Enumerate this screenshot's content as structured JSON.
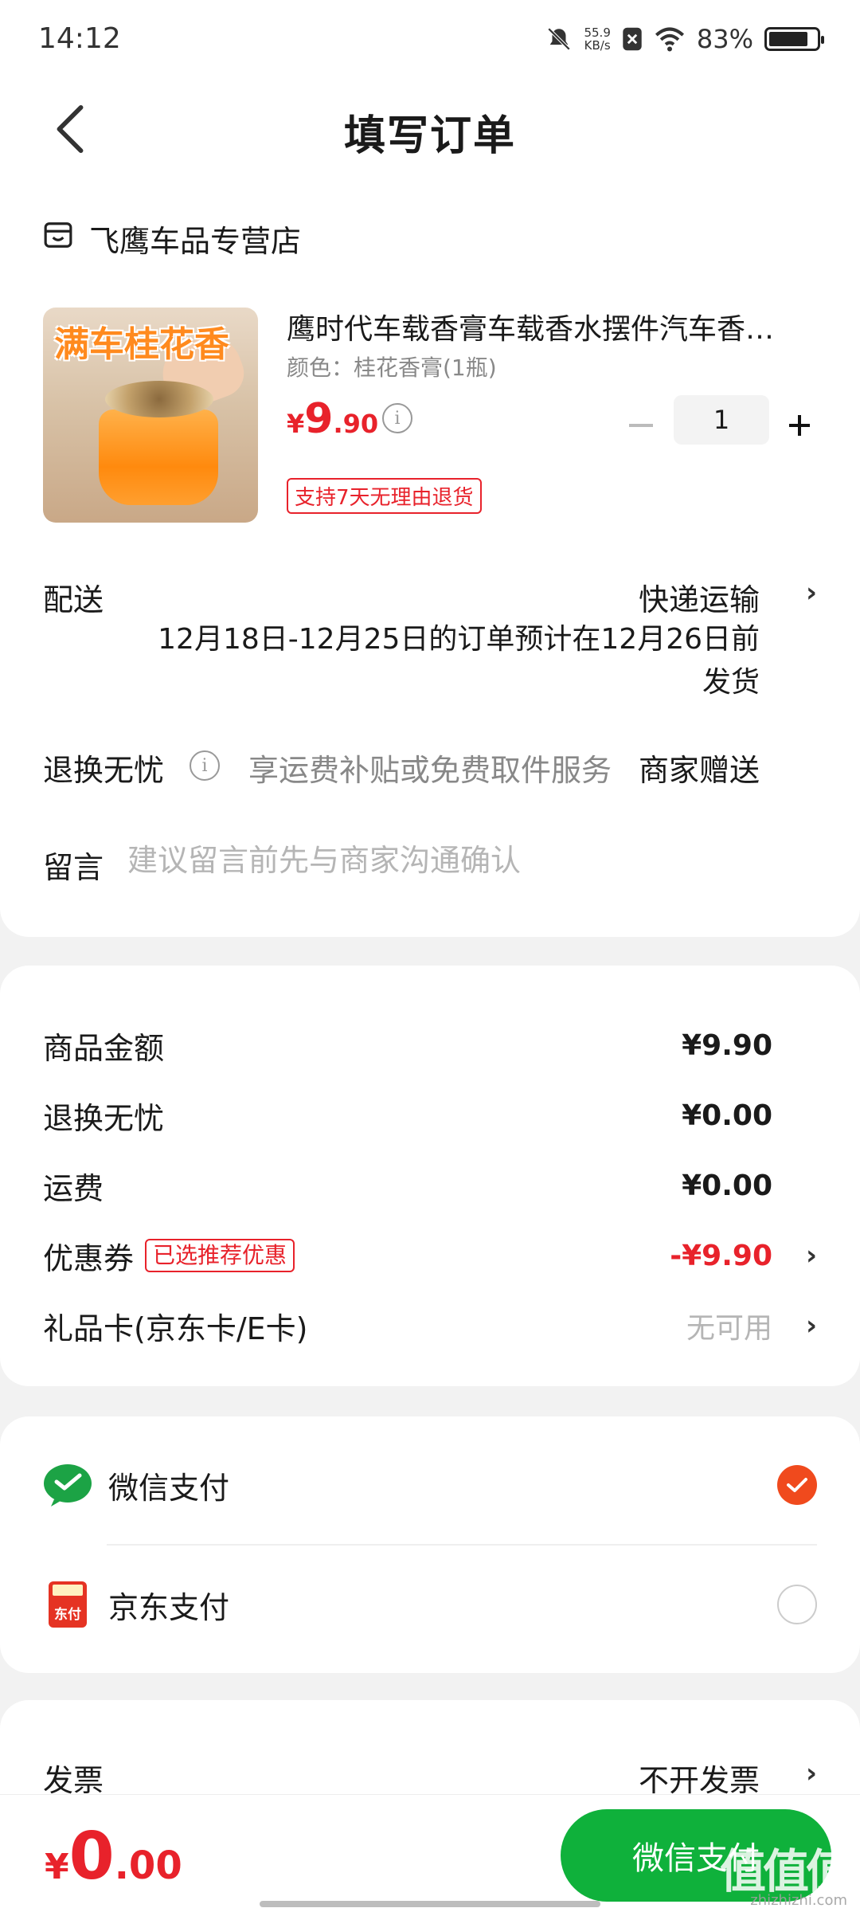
{
  "status_bar": {
    "time": "14:12",
    "net_speed": "55.9",
    "net_unit": "KB/s",
    "battery": "83%",
    "battery_level": 0.83
  },
  "nav": {
    "title": "填写订单"
  },
  "shop": {
    "name": "飞鹰车品专营店"
  },
  "product": {
    "image_text": "满车桂花香",
    "name": "鹰时代车载香膏车载香水摆件汽车香…",
    "attr": "颜色：桂花香膏(1瓶)",
    "price_symbol": "¥",
    "price_int": "9",
    "price_dec": ".90",
    "quantity": "1",
    "return_tag": "支持7天无理由退货"
  },
  "delivery": {
    "label": "配送",
    "value": "快递运输",
    "note": "12月18日-12月25日的订单预计在12月26日前发货"
  },
  "worry_free": {
    "label": "退换无忧",
    "desc": "享运费补贴或免费取件服务",
    "value": "商家赠送"
  },
  "message": {
    "label": "留言",
    "placeholder": "建议留言前先与商家沟通确认"
  },
  "summary": {
    "goods_label": "商品金额",
    "goods_value": "¥9.90",
    "worry_label": "退换无忧",
    "worry_value": "¥0.00",
    "freight_label": "运费",
    "freight_value": "¥0.00",
    "coupon_label": "优惠券",
    "coupon_tag": "已选推荐优惠",
    "coupon_value": "-¥9.90",
    "giftcard_label": "礼品卡(京东卡/E卡)",
    "giftcard_value": "无可用"
  },
  "payment": {
    "wechat_label": "微信支付",
    "jd_label": "京东支付",
    "jd_icon_text": "东付",
    "selected": "wechat"
  },
  "invoice": {
    "label": "发票",
    "value": "不开发票"
  },
  "bottom": {
    "total_symbol": "¥",
    "total_int": "0",
    "total_dec": ".00",
    "pay_button": "微信支付",
    "watermark": "值值值",
    "watermark_sub": "zhizhizhi.com"
  },
  "colors": {
    "accent_red": "#e8222b",
    "pay_green": "#0fb13b",
    "radio_orange": "#f04a1d"
  }
}
